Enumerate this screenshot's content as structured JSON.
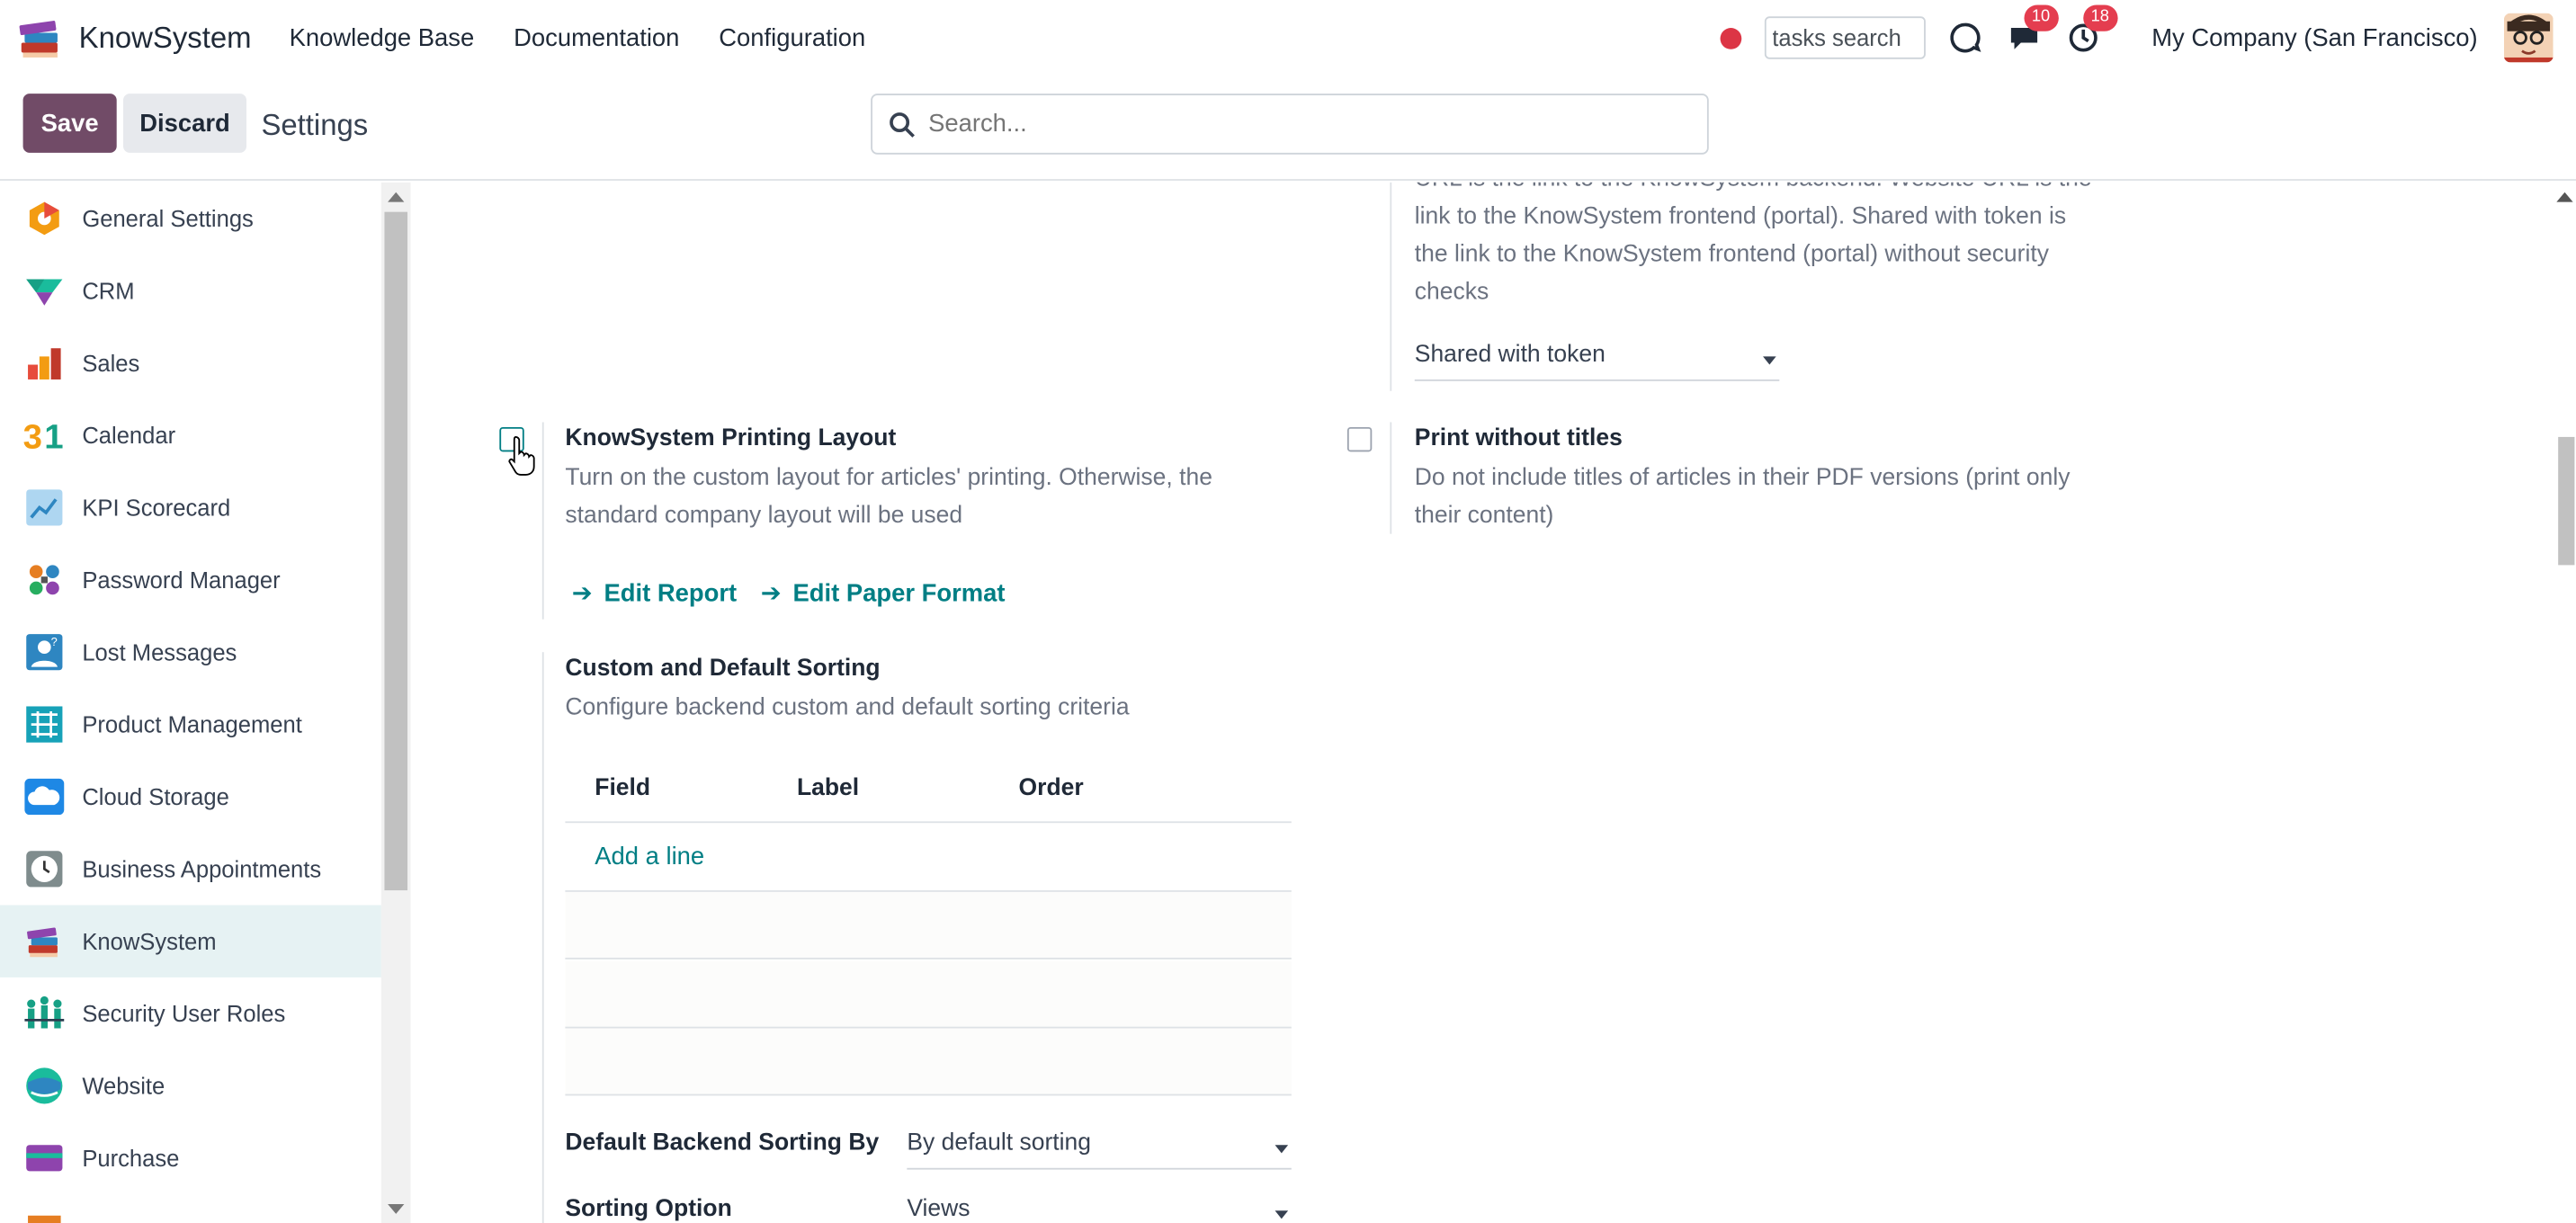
{
  "navbar": {
    "app_name": "KnowSystem",
    "menu": [
      "Knowledge Base",
      "Documentation",
      "Configuration"
    ],
    "tasks_search_value": "tasks search",
    "messages_count": "10",
    "activities_count": "18",
    "company": "My Company (San Francisco)"
  },
  "control": {
    "save_label": "Save",
    "discard_label": "Discard",
    "title": "Settings",
    "search_placeholder": "Search..."
  },
  "sidebar": {
    "items": [
      {
        "label": "General Settings",
        "icon": "general-settings-icon"
      },
      {
        "label": "CRM",
        "icon": "crm-icon"
      },
      {
        "label": "Sales",
        "icon": "sales-icon"
      },
      {
        "label": "Calendar",
        "icon": "calendar-icon"
      },
      {
        "label": "KPI Scorecard",
        "icon": "kpi-scorecard-icon"
      },
      {
        "label": "Password Manager",
        "icon": "password-manager-icon"
      },
      {
        "label": "Lost Messages",
        "icon": "lost-messages-icon"
      },
      {
        "label": "Product Management",
        "icon": "product-management-icon"
      },
      {
        "label": "Cloud Storage",
        "icon": "cloud-storage-icon"
      },
      {
        "label": "Business Appointments",
        "icon": "business-appointments-icon"
      },
      {
        "label": "KnowSystem",
        "icon": "knowsystem-icon"
      },
      {
        "label": "Security User Roles",
        "icon": "security-user-roles-icon"
      },
      {
        "label": "Website",
        "icon": "website-icon"
      },
      {
        "label": "Purchase",
        "icon": "purchase-icon"
      }
    ],
    "active_index": 10
  },
  "main": {
    "url_setting": {
      "desc_line1": "URL is the link to the KnowSystem backend. Website URL is the",
      "desc_line2": "link to the KnowSystem frontend (portal). Shared with token is",
      "desc_line3": "the link to the KnowSystem frontend (portal) without security",
      "desc_line4": "checks",
      "select_value": "Shared with token"
    },
    "printing_layout": {
      "title": "KnowSystem Printing Layout",
      "desc_line1": "Turn on the custom layout for articles' printing. Otherwise, the",
      "desc_line2": "standard company layout will be used",
      "checked": false,
      "link_report": "Edit Report",
      "link_paper": "Edit Paper Format"
    },
    "print_without_titles": {
      "title": "Print without titles",
      "desc_line1": "Do not include titles of articles in their PDF versions (print only",
      "desc_line2": "their content)",
      "checked": false
    },
    "sorting": {
      "title": "Custom and Default Sorting",
      "desc": "Configure backend custom and default sorting criteria",
      "columns": [
        "Field",
        "Label",
        "Order"
      ],
      "add_line": "Add a line",
      "default_label": "Default Backend Sorting By",
      "default_value": "By default sorting",
      "option_label": "Sorting Option",
      "option_value": "Views"
    }
  }
}
